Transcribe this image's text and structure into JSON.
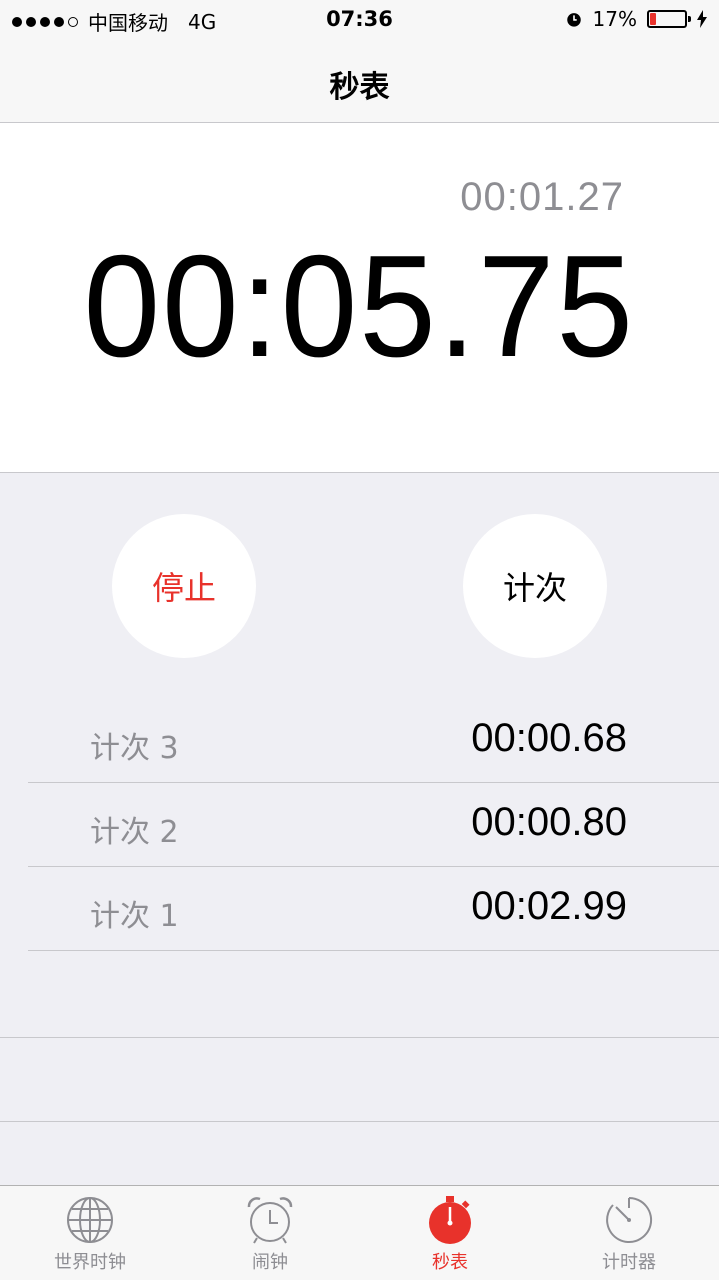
{
  "status_bar": {
    "carrier": "中国移动",
    "network": "4G",
    "time": "07:36",
    "battery_percent": "17%",
    "battery_level": 0.17
  },
  "nav": {
    "title": "秒表"
  },
  "timer": {
    "lap_time": "00:01.27",
    "main_time": "00:05.75"
  },
  "buttons": {
    "stop_label": "停止",
    "lap_label": "计次"
  },
  "laps": [
    {
      "label": "计次 3",
      "time": "00:00.68"
    },
    {
      "label": "计次 2",
      "time": "00:00.80"
    },
    {
      "label": "计次 1",
      "time": "00:02.99"
    }
  ],
  "tabs": [
    {
      "label": "世界时钟",
      "icon": "globe-icon"
    },
    {
      "label": "闹钟",
      "icon": "alarm-clock-icon"
    },
    {
      "label": "秒表",
      "icon": "stopwatch-icon"
    },
    {
      "label": "计时器",
      "icon": "timer-icon"
    }
  ],
  "colors": {
    "accent": "#e8322b",
    "secondary_text": "#8e8e93"
  }
}
